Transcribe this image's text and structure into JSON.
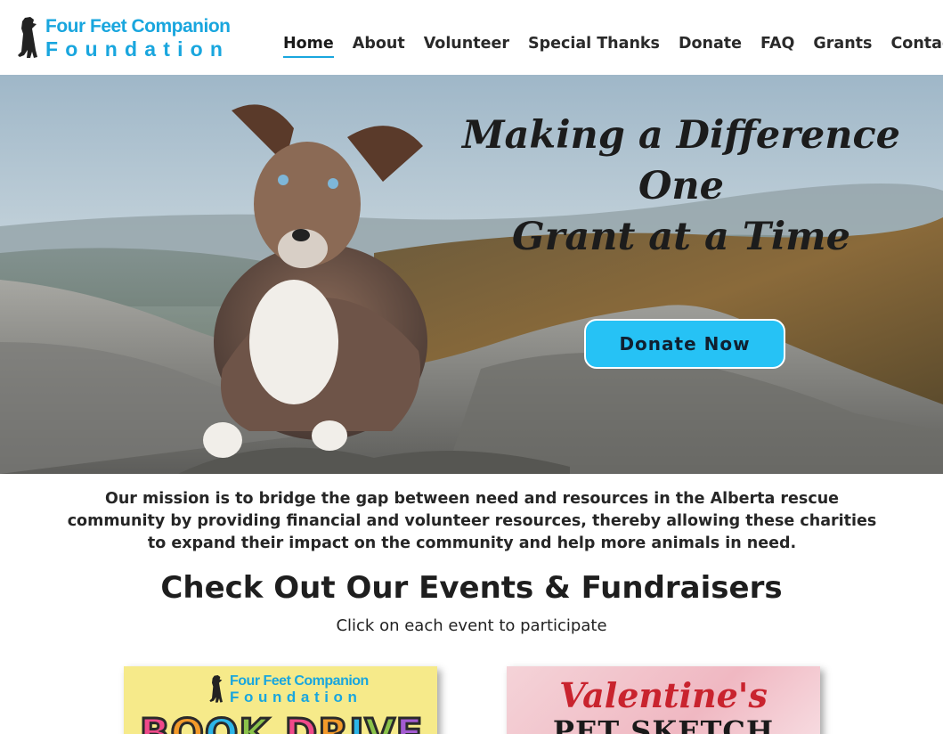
{
  "brand": {
    "line1": "Four Feet Companion",
    "line2": "Foundation",
    "color": "#19a6de"
  },
  "nav": {
    "items": [
      {
        "label": "Home",
        "active": true
      },
      {
        "label": "About"
      },
      {
        "label": "Volunteer"
      },
      {
        "label": "Special Thanks"
      },
      {
        "label": "Donate"
      },
      {
        "label": "FAQ"
      },
      {
        "label": "Grants"
      },
      {
        "label": "Contact"
      }
    ]
  },
  "hero": {
    "title_line1": "Making a Difference One",
    "title_line2": "Grant at a Time",
    "button_label": "Donate Now",
    "button_color": "#26c2f5"
  },
  "mission": {
    "text": "Our mission is to bridge the gap between need and resources in the Alberta rescue community by providing financial and volunteer resources, thereby allowing these charities to expand their impact on the community and help more animals in need."
  },
  "events": {
    "title": "Check Out Our Events & Fundraisers",
    "subtitle": "Click on each event to participate",
    "cards": [
      {
        "logo_line1": "Four Feet Companion",
        "logo_line2": "Foundation",
        "headline": "BOOK DRIVE"
      },
      {
        "script": "Valentine's",
        "headline": "PET SKETCH"
      }
    ]
  }
}
